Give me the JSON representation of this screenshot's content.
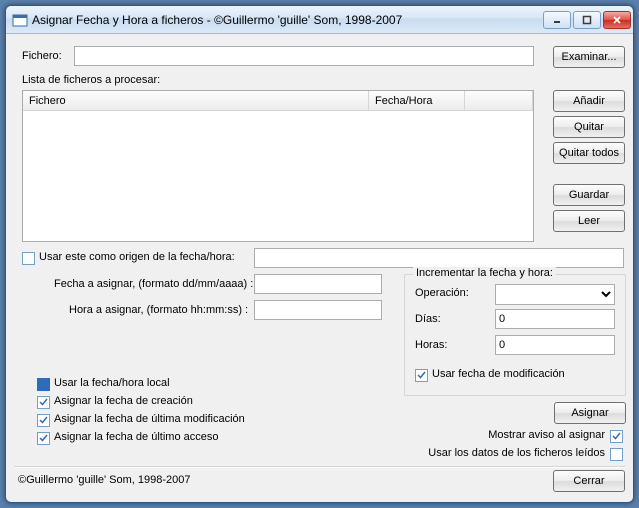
{
  "window": {
    "title": "Asignar Fecha y Hora a ficheros - ©Guillermo 'guille' Som, 1998-2007"
  },
  "fichero_label": "Fichero:",
  "fichero_value": "",
  "examinar": "Examinar...",
  "list_title": "Lista de ficheros a procesar:",
  "columns": {
    "file": "Fichero",
    "datetime": "Fecha/Hora"
  },
  "side_buttons": {
    "add": "Añadir",
    "remove": "Quitar",
    "remove_all": "Quitar todos",
    "save": "Guardar",
    "read": "Leer"
  },
  "use_source_label": "Usar este como origen de la fecha/hora:",
  "use_source_value": "",
  "fecha_label": "Fecha a asignar, (formato dd/mm/aaaa) :",
  "fecha_value": "",
  "hora_label": "Hora a asignar, (formato hh:mm:ss) :",
  "hora_value": "",
  "increment": {
    "title": "Incrementar la fecha y hora:",
    "operacion_label": "Operación:",
    "operacion_value": "",
    "dias_label": "Días:",
    "dias_value": "0",
    "horas_label": "Horas:",
    "horas_value": "0",
    "use_mod_label": "Usar fecha de modificación"
  },
  "options": {
    "use_local": "Usar la fecha/hora local",
    "assign_creation": "Asignar la fecha de creación",
    "assign_mod": "Asignar la fecha de última modificación",
    "assign_access": "Asignar la fecha de último acceso",
    "show_notice": "Mostrar aviso al asignar",
    "use_read_data": "Usar los datos de los ficheros leídos"
  },
  "asignar": "Asignar",
  "footer": "©Guillermo 'guille' Som, 1998-2007",
  "cerrar": "Cerrar"
}
